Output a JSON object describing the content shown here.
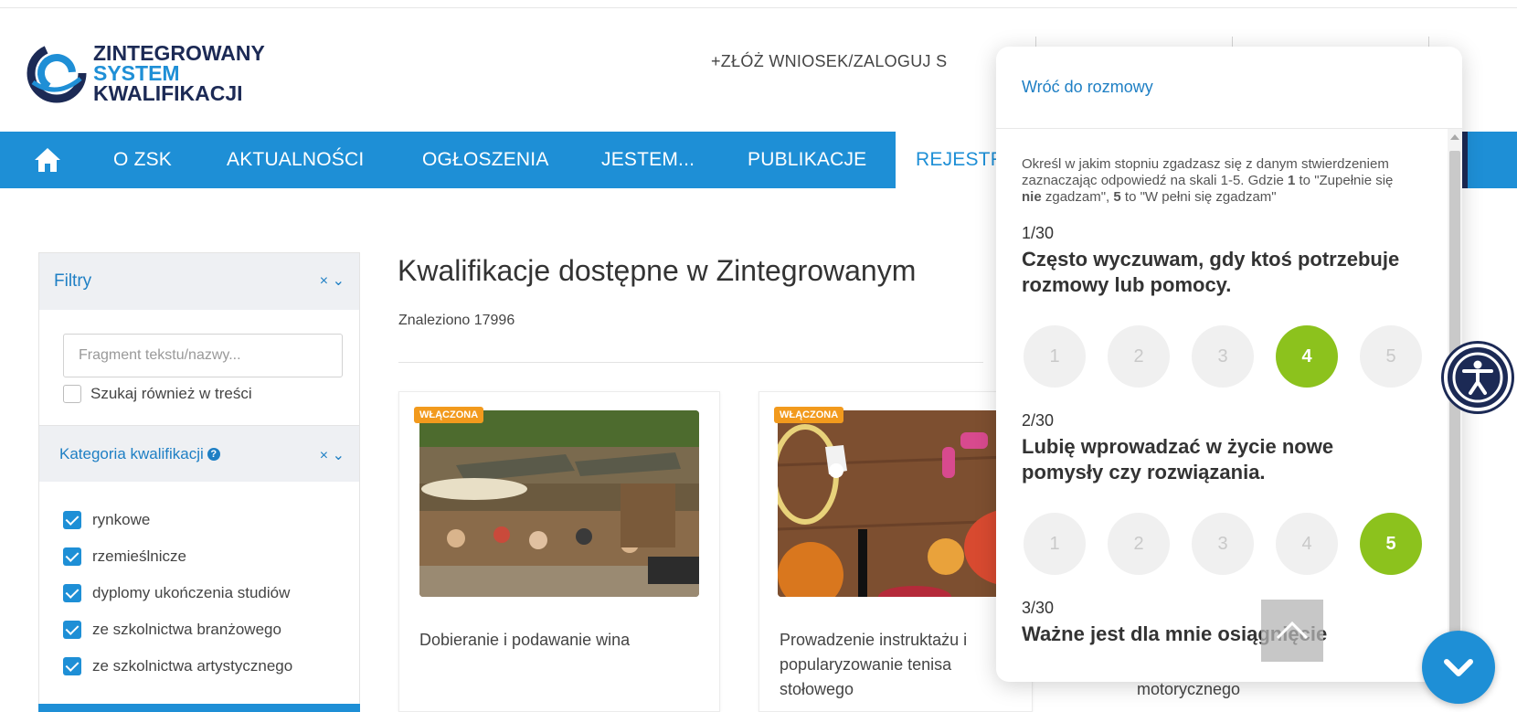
{
  "header": {
    "logo_line1": "ZINTEGROWANY",
    "logo_line2": "SYSTEM",
    "logo_line3": "KWALIFIKACJI",
    "login_link": "+ZŁÓŻ WNIOSEK/ZALOGUJ S"
  },
  "nav": {
    "items": [
      "O ZSK",
      "AKTUALNOŚCI",
      "OGŁOSZENIA",
      "JESTEM...",
      "PUBLIKACJE",
      "REJESTR"
    ],
    "active_index": 5
  },
  "filters": {
    "title": "Filtry",
    "controls": "× ⌄",
    "search_placeholder": "Fragment tekstu/nazwy...",
    "search_in_content": "Szukaj również w treści",
    "category_title": "Kategoria kwalifikacji",
    "categories": [
      "rynkowe",
      "rzemieślnicze",
      "dyplomy ukończenia studiów",
      "ze szkolnictwa branżowego",
      "ze szkolnictwa artystycznego"
    ]
  },
  "main": {
    "title": "Kwalifikacje dostępne w Zintegrowanym",
    "found": "Znaleziono 17996",
    "cards": [
      {
        "badge": "WŁĄCZONA",
        "title": "Dobieranie i podawanie wina"
      },
      {
        "badge": "WŁĄCZONA",
        "title": "Prowadzenie instruktażu i popularyzowanie tenisa stołowego"
      }
    ],
    "peek_text": "motorycznego"
  },
  "chat": {
    "back_link": "Wróć do rozmowy",
    "instruction_a": "Określ w jakim stopniu zgadzasz się z danym stwierdzeniem zaznaczając odpowiedź na skali 1-5. Gdzie ",
    "instruction_b": "1",
    "instruction_c": " to \"Zupełnie się ",
    "instruction_d": "nie",
    "instruction_e": " zgadzam\", ",
    "instruction_f": "5",
    "instruction_g": " to \"W pełni się zgadzam\"",
    "questions": [
      {
        "num": "1/30",
        "text": "Często wyczuwam, gdy ktoś potrzebuje rozmowy lub pomocy.",
        "selected": 4
      },
      {
        "num": "2/30",
        "text": "Lubię wprowadzać w życie nowe pomysły czy rozwiązania.",
        "selected": 5
      },
      {
        "num": "3/30",
        "text": "Ważne jest dla mnie osiągnięcie"
      }
    ],
    "scale": [
      "1",
      "2",
      "3",
      "4",
      "5"
    ]
  },
  "colors": {
    "primary_blue": "#1e8fd6",
    "navy": "#1c2a55",
    "selected_green": "#8cc21d",
    "badge_orange": "#f29a1d"
  }
}
